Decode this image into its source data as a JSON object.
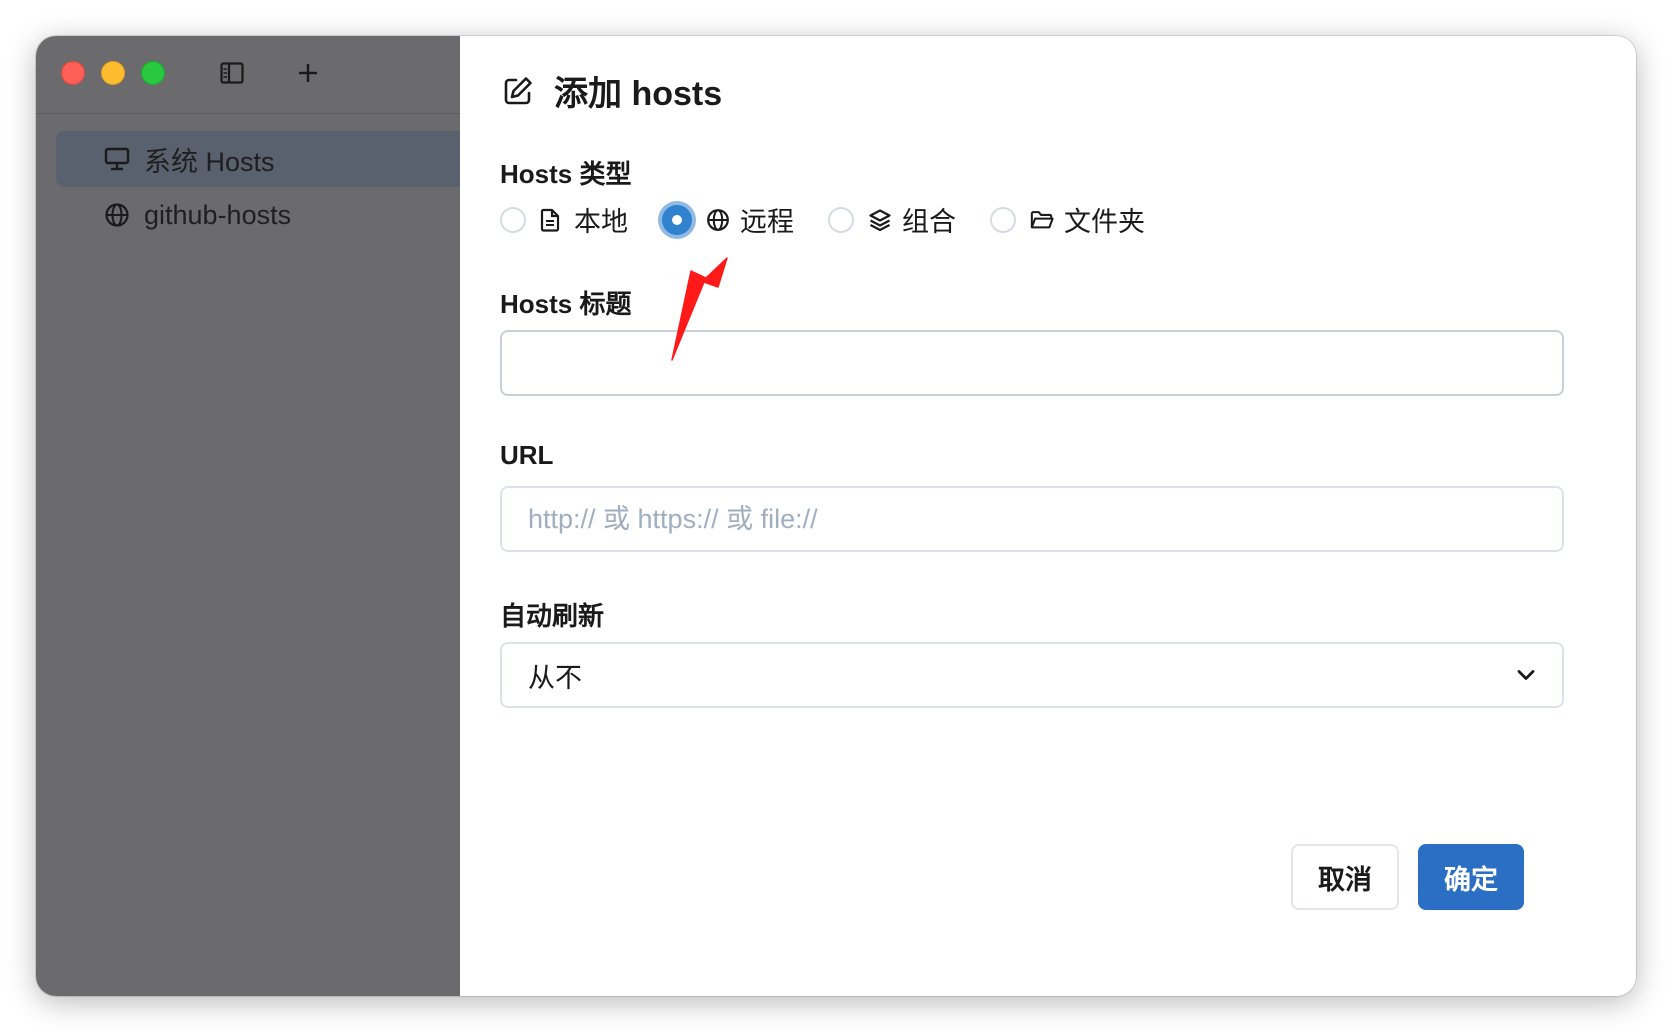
{
  "sidebar": {
    "items": [
      {
        "label": "系统 Hosts",
        "icon": "monitor-icon",
        "active": true
      },
      {
        "label": "github-hosts",
        "icon": "globe-icon",
        "active": false
      }
    ]
  },
  "dialog": {
    "title": "添加 hosts",
    "hosts_type_label": "Hosts 类型",
    "hosts_types": [
      {
        "label": "本地",
        "icon": "file-icon",
        "checked": false
      },
      {
        "label": "远程",
        "icon": "globe-icon",
        "checked": true
      },
      {
        "label": "组合",
        "icon": "layers-icon",
        "checked": false
      },
      {
        "label": "文件夹",
        "icon": "folder-open-icon",
        "checked": false
      }
    ],
    "title_label": "Hosts 标题",
    "title_value": "",
    "url_label": "URL",
    "url_placeholder": "http:// 或 https:// 或 file://",
    "refresh_label": "自动刷新",
    "refresh_value": "从不",
    "cancel_label": "取消",
    "ok_label": "确定"
  },
  "colors": {
    "accent": "#2b6fc4",
    "sidebar_bg": "#6b6b6d",
    "annotation_arrow": "#ff1a1a"
  }
}
